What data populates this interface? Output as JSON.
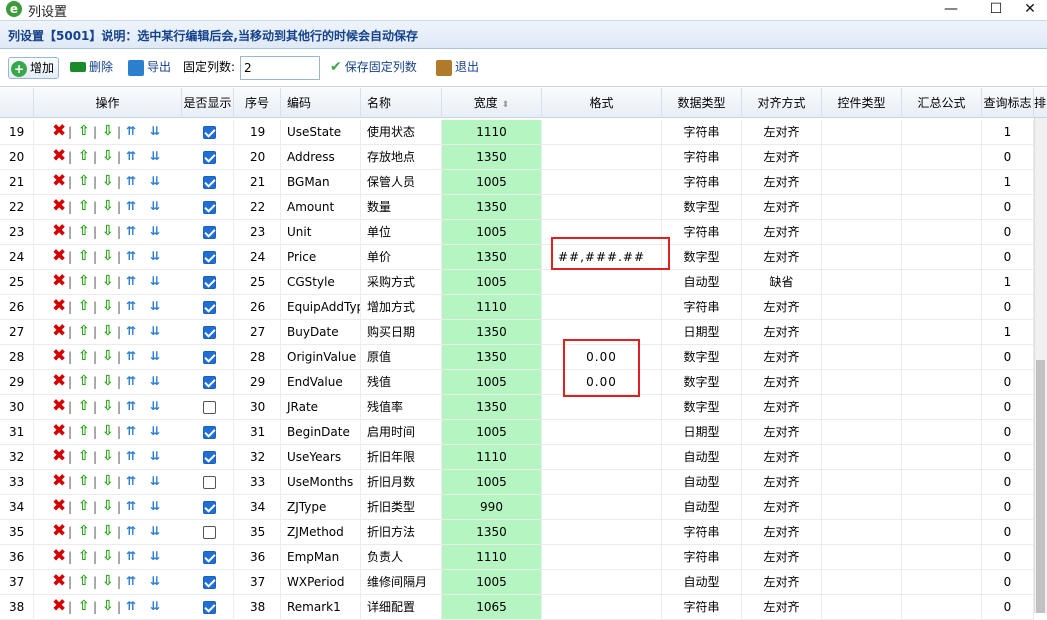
{
  "window": {
    "title": "列设置",
    "minimize": "—",
    "maximize": "☐",
    "close": "✕"
  },
  "info_text": "列设置【5001】说明：选中某行编辑后会,当移动到其他行的时候会自动保存",
  "toolbar": {
    "add": "增加",
    "delete": "删除",
    "export": "导出",
    "fixed_label": "固定列数:",
    "fixed_value": "2",
    "save_fixed": "保存固定列数",
    "exit": "退出"
  },
  "headers": {
    "ops": "操作",
    "show": "是否显示",
    "seq": "序号",
    "code": "编码",
    "name": "名称",
    "width": "宽度",
    "format": "格式",
    "dtype": "数据类型",
    "align": "对齐方式",
    "ctrl": "控件类型",
    "sum": "汇总公式",
    "query": "查询标志",
    "sort": "排"
  },
  "rows": [
    {
      "rn": "19",
      "show": true,
      "seq": "19",
      "code": "UseState",
      "name": "使用状态",
      "width": "1110",
      "format": "",
      "dtype": "字符串",
      "align": "左对齐",
      "query": "1"
    },
    {
      "rn": "20",
      "show": true,
      "seq": "20",
      "code": "Address",
      "name": "存放地点",
      "width": "1350",
      "format": "",
      "dtype": "字符串",
      "align": "左对齐",
      "query": "0"
    },
    {
      "rn": "21",
      "show": true,
      "seq": "21",
      "code": "BGMan",
      "name": "保管人员",
      "width": "1005",
      "format": "",
      "dtype": "字符串",
      "align": "左对齐",
      "query": "1"
    },
    {
      "rn": "22",
      "show": true,
      "seq": "22",
      "code": "Amount",
      "name": "数量",
      "width": "1350",
      "format": "",
      "dtype": "数字型",
      "align": "左对齐",
      "query": "0"
    },
    {
      "rn": "23",
      "show": true,
      "seq": "23",
      "code": "Unit",
      "name": "单位",
      "width": "1005",
      "format": "",
      "dtype": "字符串",
      "align": "左对齐",
      "query": "0"
    },
    {
      "rn": "24",
      "show": true,
      "seq": "24",
      "code": "Price",
      "name": "单价",
      "width": "1350",
      "format": "##,###.##",
      "dtype": "数字型",
      "align": "左对齐",
      "query": "0"
    },
    {
      "rn": "25",
      "show": true,
      "seq": "25",
      "code": "CGStyle",
      "name": "采购方式",
      "width": "1005",
      "format": "",
      "dtype": "自动型",
      "align": "缺省",
      "query": "1"
    },
    {
      "rn": "26",
      "show": true,
      "seq": "26",
      "code": "EquipAddType",
      "name": "增加方式",
      "width": "1110",
      "format": "",
      "dtype": "字符串",
      "align": "左对齐",
      "query": "0"
    },
    {
      "rn": "27",
      "show": true,
      "seq": "27",
      "code": "BuyDate",
      "name": "购买日期",
      "width": "1350",
      "format": "",
      "dtype": "日期型",
      "align": "左对齐",
      "query": "1"
    },
    {
      "rn": "28",
      "show": true,
      "seq": "28",
      "code": "OriginValue",
      "name": "原值",
      "width": "1350",
      "format": "0.00",
      "dtype": "数字型",
      "align": "左对齐",
      "query": "0"
    },
    {
      "rn": "29",
      "show": true,
      "seq": "29",
      "code": "EndValue",
      "name": "残值",
      "width": "1005",
      "format": "0.00",
      "dtype": "数字型",
      "align": "左对齐",
      "query": "0"
    },
    {
      "rn": "30",
      "show": false,
      "seq": "30",
      "code": "JRate",
      "name": "残值率",
      "width": "1350",
      "format": "",
      "dtype": "数字型",
      "align": "左对齐",
      "query": "0"
    },
    {
      "rn": "31",
      "show": true,
      "seq": "31",
      "code": "BeginDate",
      "name": "启用时间",
      "width": "1005",
      "format": "",
      "dtype": "日期型",
      "align": "左对齐",
      "query": "0"
    },
    {
      "rn": "32",
      "show": true,
      "seq": "32",
      "code": "UseYears",
      "name": "折旧年限",
      "width": "1110",
      "format": "",
      "dtype": "自动型",
      "align": "左对齐",
      "query": "0"
    },
    {
      "rn": "33",
      "show": false,
      "seq": "33",
      "code": "UseMonths",
      "name": "折旧月数",
      "width": "1005",
      "format": "",
      "dtype": "自动型",
      "align": "左对齐",
      "query": "0"
    },
    {
      "rn": "34",
      "show": true,
      "seq": "34",
      "code": "ZJType",
      "name": "折旧类型",
      "width": "990",
      "format": "",
      "dtype": "自动型",
      "align": "左对齐",
      "query": "0"
    },
    {
      "rn": "35",
      "show": false,
      "seq": "35",
      "code": "ZJMethod",
      "name": "折旧方法",
      "width": "1350",
      "format": "",
      "dtype": "字符串",
      "align": "左对齐",
      "query": "0"
    },
    {
      "rn": "36",
      "show": true,
      "seq": "36",
      "code": "EmpMan",
      "name": "负责人",
      "width": "1110",
      "format": "",
      "dtype": "字符串",
      "align": "左对齐",
      "query": "0"
    },
    {
      "rn": "37",
      "show": true,
      "seq": "37",
      "code": "WXPeriod",
      "name": "维修间隔月",
      "width": "1005",
      "format": "",
      "dtype": "自动型",
      "align": "左对齐",
      "query": "0"
    },
    {
      "rn": "38",
      "show": true,
      "seq": "38",
      "code": "Remark1",
      "name": "详细配置",
      "width": "1065",
      "format": "",
      "dtype": "字符串",
      "align": "左对齐",
      "query": "0"
    }
  ],
  "icons": {
    "delete": "✖",
    "up": "⇧",
    "down": "⇩",
    "top": "⇈",
    "bottom": "⇊",
    "sep": "|"
  },
  "colors": {
    "width_bg": "#b4f5c1",
    "highlight": "#e02020",
    "header_text": "#15428b"
  }
}
